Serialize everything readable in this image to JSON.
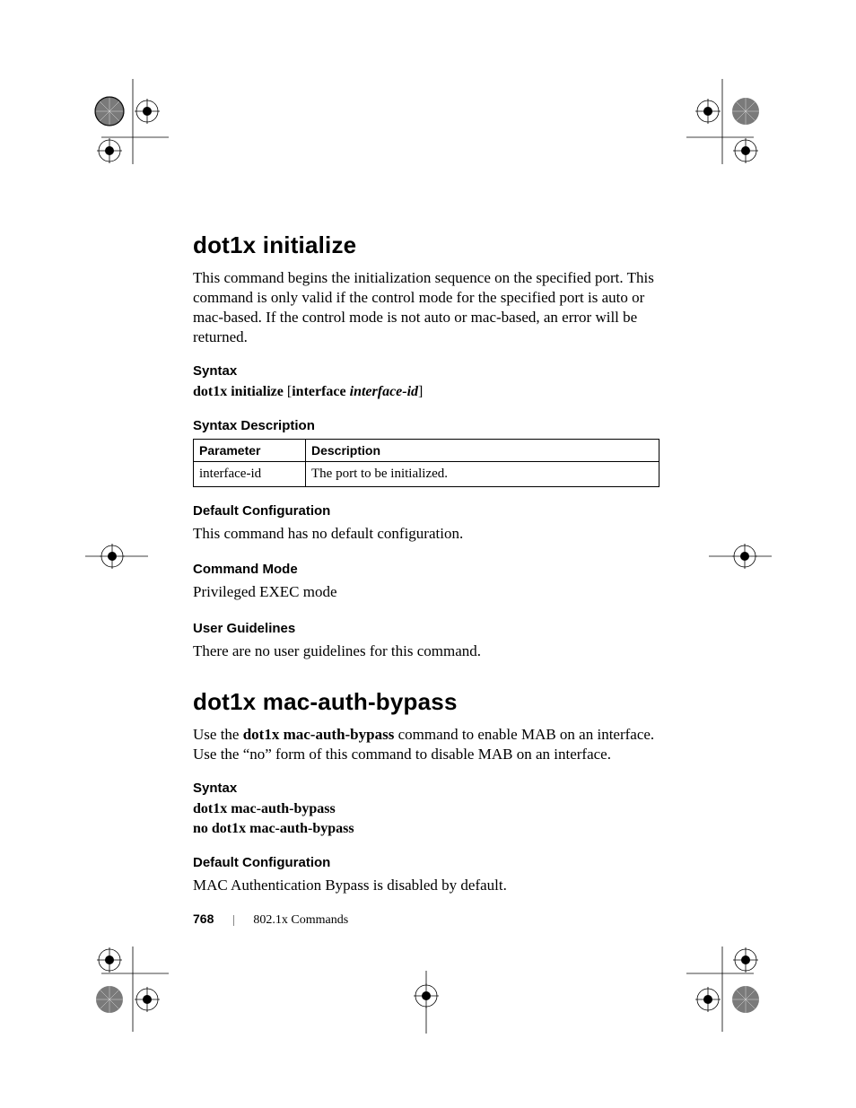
{
  "section1": {
    "title": "dot1x initialize",
    "intro": "This command begins the initialization sequence on the specified port. This command is only valid if the control mode for the specified port is auto or mac-based. If the control mode is not auto or mac-based, an error will be returned.",
    "syntax_heading": "Syntax",
    "syntax_cmd_bold1": "dot1x initialize",
    "syntax_cmd_bracket_open": " [",
    "syntax_cmd_bold2": "interface ",
    "syntax_cmd_italic": "interface-id",
    "syntax_cmd_bracket_close": "]",
    "syntax_desc_heading": "Syntax Description",
    "table_header_param": "Parameter",
    "table_header_desc": "Description",
    "table_row1_param": "interface-id",
    "table_row1_desc": "The port to be initialized.",
    "default_config_heading": "Default Configuration",
    "default_config_text": "This command has no default configuration.",
    "command_mode_heading": "Command Mode",
    "command_mode_text": "Privileged EXEC mode",
    "user_guidelines_heading": "User Guidelines",
    "user_guidelines_text": "There are no user guidelines for this command."
  },
  "section2": {
    "title": "dot1x mac-auth-bypass",
    "intro_part1": "Use the ",
    "intro_bold": "dot1x mac-auth-bypass",
    "intro_part2": " command to enable MAB on an interface. Use the “no” form of this command to disable MAB on an interface.",
    "syntax_heading": "Syntax",
    "syntax_line1": "dot1x mac-auth-bypass",
    "syntax_line2": "no dot1x mac-auth-bypass",
    "default_config_heading": "Default Configuration",
    "default_config_text": "MAC Authentication Bypass is disabled by default."
  },
  "footer": {
    "page": "768",
    "title": "802.1x Commands"
  }
}
